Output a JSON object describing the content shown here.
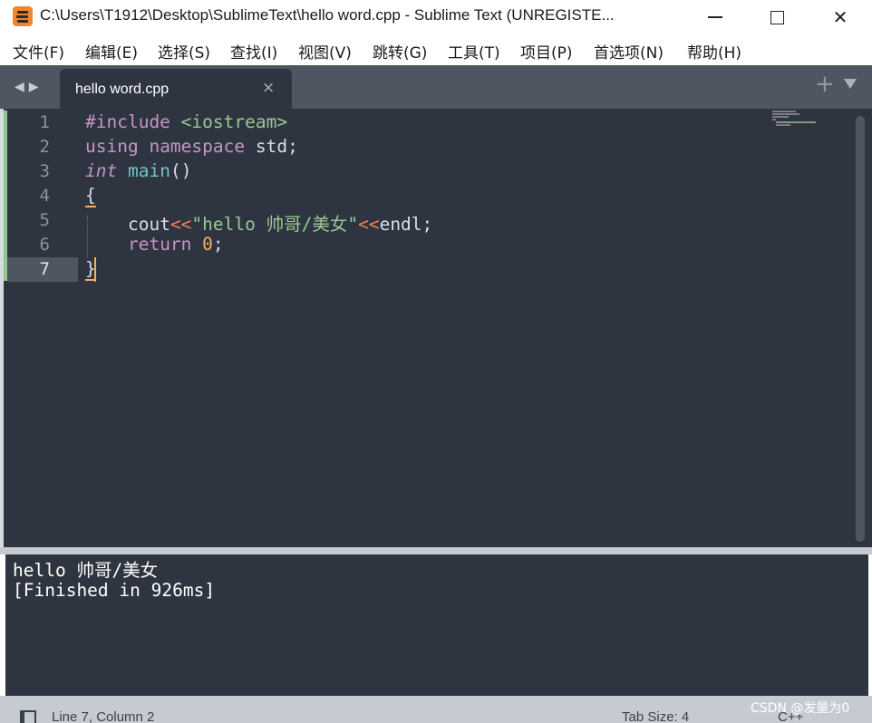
{
  "window": {
    "title": "C:\\Users\\T1912\\Desktop\\SublimeText\\hello word.cpp - Sublime Text (UNREGISTE...",
    "app_icon": "sublime-text-icon",
    "minimize_icon": "minimize-icon",
    "maximize_icon": "maximize-icon",
    "close_icon": "close-icon",
    "close_glyph": "✕"
  },
  "menu": {
    "items": [
      {
        "label": "文件(F)"
      },
      {
        "label": "编辑(E)"
      },
      {
        "label": "选择(S)"
      },
      {
        "label": "查找(I)"
      },
      {
        "label": "视图(V)"
      },
      {
        "label": "跳转(G)"
      },
      {
        "label": "工具(T)"
      },
      {
        "label": "项目(P)"
      },
      {
        "label": "首选项(N)"
      },
      {
        "label": "帮助(H)"
      }
    ]
  },
  "tabbar": {
    "nav_glyph": "◀▶",
    "tab_label": "hello word.cpp",
    "tab_close_glyph": "×",
    "new_tab_glyph": "+",
    "new_tab_icon": "plus-icon",
    "tab_list_icon": "chevron-down-icon"
  },
  "editor": {
    "line_numbers": [
      "1",
      "2",
      "3",
      "4",
      "5",
      "6",
      "7"
    ],
    "active_line": "7",
    "code": {
      "l1_directive": "#include",
      "l1_space": " ",
      "l1_header": "<iostream>",
      "l2_using": "using",
      "l2_namespace": "namespace",
      "l2_rest": " std;",
      "l3_type": "int",
      "l3_fn": "main",
      "l3_rest": "()",
      "l4": "{",
      "l5_indent": "    ",
      "l5_cout": "cout",
      "l5_op1": "<<",
      "l5_str": "\"hello 帅哥/美女\"",
      "l5_op2": "<<",
      "l5_rest": "endl;",
      "l6_indent": "    ",
      "l6_return": "return",
      "l6_num": "0",
      "l6_semi": ";",
      "l7": "}"
    }
  },
  "output": {
    "lines": [
      "hello 帅哥/美女",
      "[Finished in 926ms]"
    ]
  },
  "statusbar": {
    "panel_icon": "panel-toggle-icon",
    "position": "Line 7, Column 2",
    "tab_size": "Tab Size: 4",
    "syntax": "C++",
    "watermark": "CSDN @发量为0"
  },
  "colors": {
    "editor_bg": "#2f3540",
    "tabbar_bg": "#4f5561",
    "keyword": "#c594c5",
    "function": "#6ec6c8",
    "string": "#99c794",
    "number": "#f9ae58",
    "operator": "#f97b58",
    "cursor": "#f9ae58",
    "gutter_mark": "#8fc88a"
  }
}
